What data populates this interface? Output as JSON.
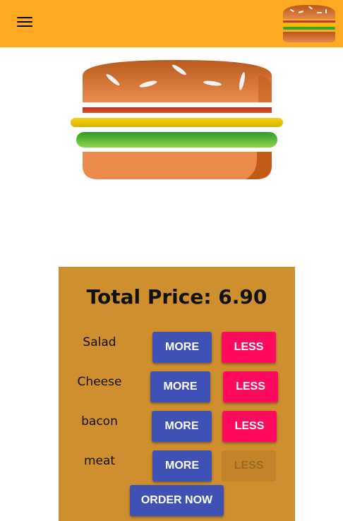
{
  "toolbar": {
    "menu_icon": "hamburger-menu-icon",
    "logo_icon": "burger-logo-icon",
    "background": "#ffaa22"
  },
  "burger": {
    "layers": [
      "seeds-bun",
      "bacon",
      "cheese",
      "salad",
      "bottom-bun"
    ]
  },
  "build_controls": {
    "price_label": "Total Price: 6.90",
    "controls": [
      {
        "label": "Salad",
        "more": "MORE",
        "less": "LESS",
        "less_disabled": false
      },
      {
        "label": "Cheese",
        "more": "MORE",
        "less": "LESS",
        "less_disabled": false
      },
      {
        "label": "bacon",
        "more": "MORE",
        "less": "LESS",
        "less_disabled": false
      },
      {
        "label": "meat",
        "more": "MORE",
        "less": "LESS",
        "less_disabled": true
      }
    ],
    "order_label": "ORDER NOW"
  },
  "colors": {
    "more_button": "#3f51b5",
    "less_button": "#ff0a5f",
    "controls_background": "#cf8f2e"
  }
}
